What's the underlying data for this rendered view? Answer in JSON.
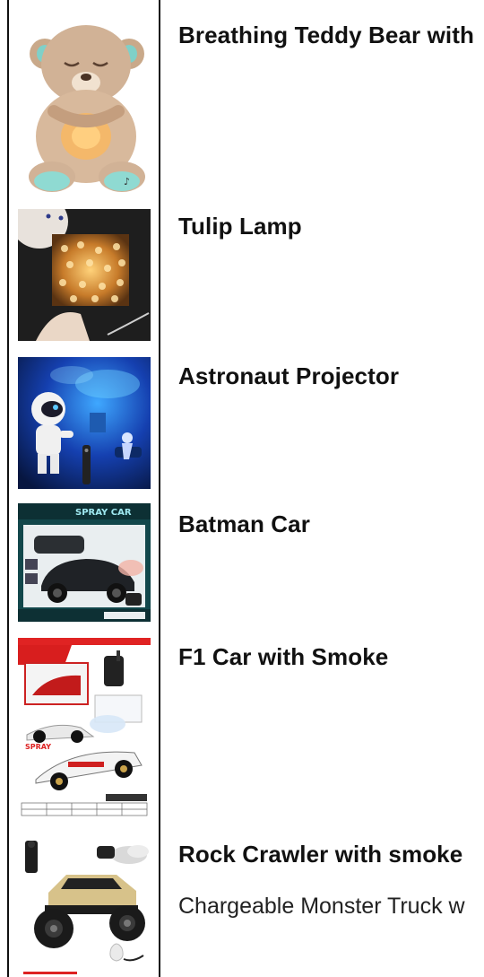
{
  "products": [
    {
      "title": "Breathing Teddy Bear with",
      "image": "teddy-bear-product-image"
    },
    {
      "title": "Tulip Lamp",
      "image": "tulip-lamp-product-image"
    },
    {
      "title": "Astronaut Projector",
      "image": "astronaut-projector-product-image"
    },
    {
      "title": "Batman Car",
      "image": "batman-car-product-image",
      "image_text": "SPRAY CAR"
    },
    {
      "title": "F1 Car with Smoke",
      "image": "f1-car-product-image",
      "image_text": "SPRAY"
    },
    {
      "title": "Rock Crawler with smoke",
      "description": "Chargeable Monster Truck w",
      "image": "rock-crawler-product-image"
    }
  ]
}
